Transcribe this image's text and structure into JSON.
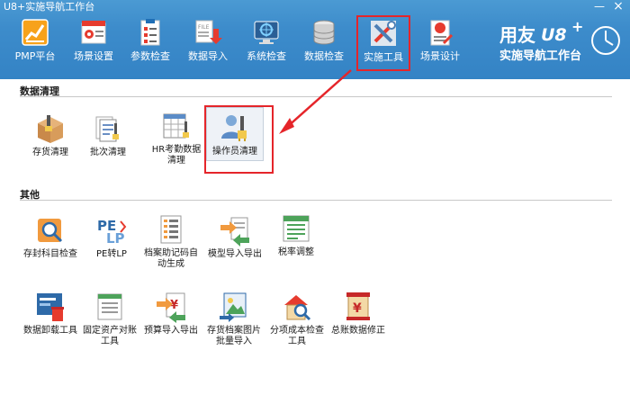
{
  "window": {
    "title": "U8+实施导航工作台",
    "minimize": "—",
    "close": "×"
  },
  "toolbar": [
    {
      "label": "PMP平台",
      "icon": "bar-chart-icon"
    },
    {
      "label": "场景设置",
      "icon": "scene-settings-icon"
    },
    {
      "label": "参数检查",
      "icon": "checklist-icon"
    },
    {
      "label": "数据导入",
      "icon": "file-import-icon"
    },
    {
      "label": "系统检查",
      "icon": "monitor-check-icon"
    },
    {
      "label": "数据检查",
      "icon": "database-icon"
    },
    {
      "label": "实施工具",
      "icon": "tools-icon",
      "active": true
    },
    {
      "label": "场景设计",
      "icon": "design-icon"
    }
  ],
  "brand": {
    "name": "用友",
    "version": "U8",
    "plus": "+",
    "subtitle": "实施导航工作台"
  },
  "sections": {
    "data_cleanup": {
      "title": "数据清理",
      "items": [
        {
          "label": "存货清理",
          "icon": "inventory-box-icon"
        },
        {
          "label": "批次清理",
          "icon": "batch-document-icon"
        },
        {
          "label": "HR考勤数据清理",
          "icon": "table-brush-icon"
        },
        {
          "label": "操作员清理",
          "icon": "operator-brush-icon",
          "selected": true
        }
      ]
    },
    "other": {
      "title": "其他",
      "row1": [
        {
          "label": "存封科目检查",
          "icon": "box-search-icon"
        },
        {
          "label": "PE转LP",
          "icon": "pe-lp-icon"
        },
        {
          "label": "档案助记码自动生成",
          "icon": "list-generate-icon"
        },
        {
          "label": "模型导入导出",
          "icon": "model-transfer-icon"
        },
        {
          "label": "税率调整",
          "icon": "tax-rate-icon"
        }
      ],
      "row2": [
        {
          "label": "数据卸载工具",
          "icon": "data-uninstall-icon"
        },
        {
          "label": "固定资产对账工具",
          "icon": "asset-reconcile-icon"
        },
        {
          "label": "预算导入导出",
          "icon": "budget-transfer-icon"
        },
        {
          "label": "存货档案图片批量导入",
          "icon": "image-import-icon"
        },
        {
          "label": "分项成本检查工具",
          "icon": "cost-check-icon"
        },
        {
          "label": "总账数据修正",
          "icon": "ledger-fix-icon"
        }
      ]
    }
  },
  "colors": {
    "titlebar": "#3d8ccb",
    "highlight": "#e5252a",
    "text": "#1a1a1a"
  }
}
